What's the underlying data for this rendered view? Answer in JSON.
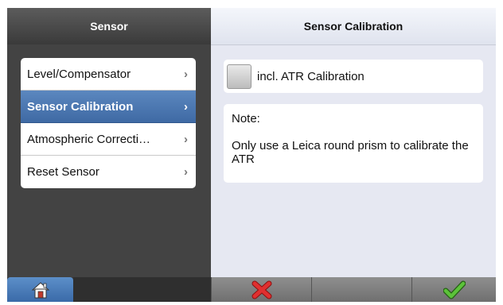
{
  "left_panel": {
    "title": "Sensor",
    "menu": [
      {
        "label": "Level/Compensator",
        "chevron": "›",
        "active": false
      },
      {
        "label": "Sensor Calibration",
        "chevron": "›",
        "active": true
      },
      {
        "label": "Atmospheric Correcti…",
        "chevron": "›",
        "active": false
      },
      {
        "label": "Reset Sensor",
        "chevron": "›",
        "active": false
      }
    ]
  },
  "right_panel": {
    "title": "Sensor Calibration",
    "checkbox": {
      "label": "incl. ATR Calibration",
      "checked": false
    },
    "note": {
      "title": "Note:",
      "text": "Only use a Leica round prism to calibrate the ATR"
    }
  },
  "footer": {
    "home_icon": "home-icon",
    "cancel_icon": "red-x-icon",
    "ok_icon": "green-check-icon"
  },
  "colors": {
    "accent_blue": "#4a78b4",
    "cancel_red": "#d62a2a",
    "ok_green": "#4aa12d"
  }
}
